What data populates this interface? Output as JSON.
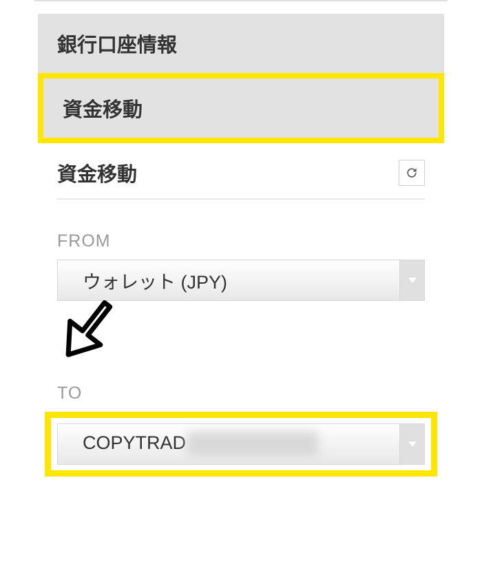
{
  "tabs": {
    "bank_info": "銀行口座情報",
    "transfer": "資金移動"
  },
  "panel": {
    "title": "資金移動",
    "from_label": "FROM",
    "to_label": "TO"
  },
  "dropdowns": {
    "from_value": "ウォレット (JPY)",
    "to_value_visible": "COPYTRAD"
  },
  "icons": {
    "refresh": "refresh-icon",
    "chevron_down": "chevron-down-icon",
    "arrow_annotation": "arrow-annotation-icon"
  },
  "colors": {
    "highlight": "#FFE600",
    "tab_bg": "#e2e2e2",
    "label": "#999999"
  }
}
